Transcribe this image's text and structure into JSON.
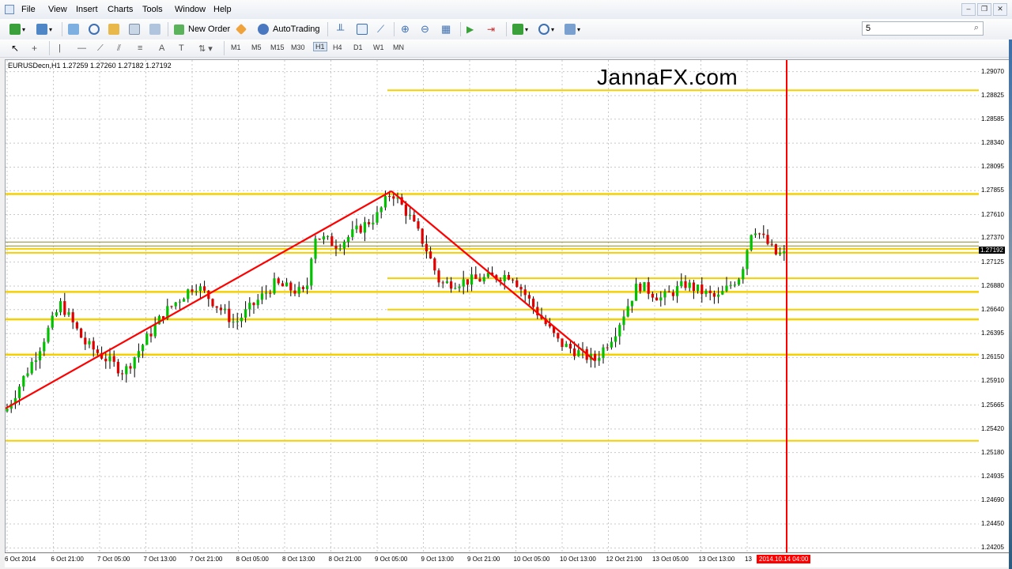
{
  "menu": [
    "File",
    "View",
    "Insert",
    "Charts",
    "Tools",
    "Window",
    "Help"
  ],
  "toolbar": {
    "new_order": "New Order",
    "autotrading": "AutoTrading",
    "search_value": "5"
  },
  "timeframes": [
    "M1",
    "M5",
    "M15",
    "M30",
    "H1",
    "H4",
    "D1",
    "W1",
    "MN"
  ],
  "chart": {
    "title": "EURUSDecn,H1  1.27259 1.27260 1.27182 1.27192",
    "watermark": "JannaFX.com",
    "current_time_label": "2014.10.14 04:00",
    "current_price": "1.27192",
    "colors": {
      "up": "#00c000",
      "down": "#e00000",
      "level": "#f5d000",
      "trend": "#ff0000",
      "vline": "#ff0000"
    }
  },
  "chart_data": {
    "type": "candlestick",
    "symbol": "EURUSDecn",
    "timeframe": "H1",
    "ylim": [
      1.242,
      1.2914
    ],
    "price_ticks": [
      "1.29070",
      "1.28825",
      "1.28585",
      "1.28340",
      "1.28095",
      "1.27855",
      "1.27610",
      "1.27370",
      "1.27125",
      "1.26880",
      "1.26640",
      "1.26395",
      "1.26150",
      "1.25910",
      "1.25665",
      "1.25420",
      "1.25180",
      "1.24935",
      "1.24690",
      "1.24450",
      "1.24205"
    ],
    "time_ticks": [
      "6 Oct 2014",
      "6 Oct 21:00",
      "7 Oct 05:00",
      "7 Oct 13:00",
      "7 Oct 21:00",
      "8 Oct 05:00",
      "8 Oct 13:00",
      "8 Oct 21:00",
      "9 Oct 05:00",
      "9 Oct 13:00",
      "9 Oct 21:00",
      "10 Oct 05:00",
      "10 Oct 13:00",
      "12 Oct 21:00",
      "13 Oct 05:00",
      "13 Oct 13:00",
      "13"
    ],
    "horizontal_levels": [
      1.2888,
      1.2782,
      1.2726,
      1.2722,
      1.2696,
      1.2682,
      1.2664,
      1.2654,
      1.2618,
      1.253
    ]
  }
}
